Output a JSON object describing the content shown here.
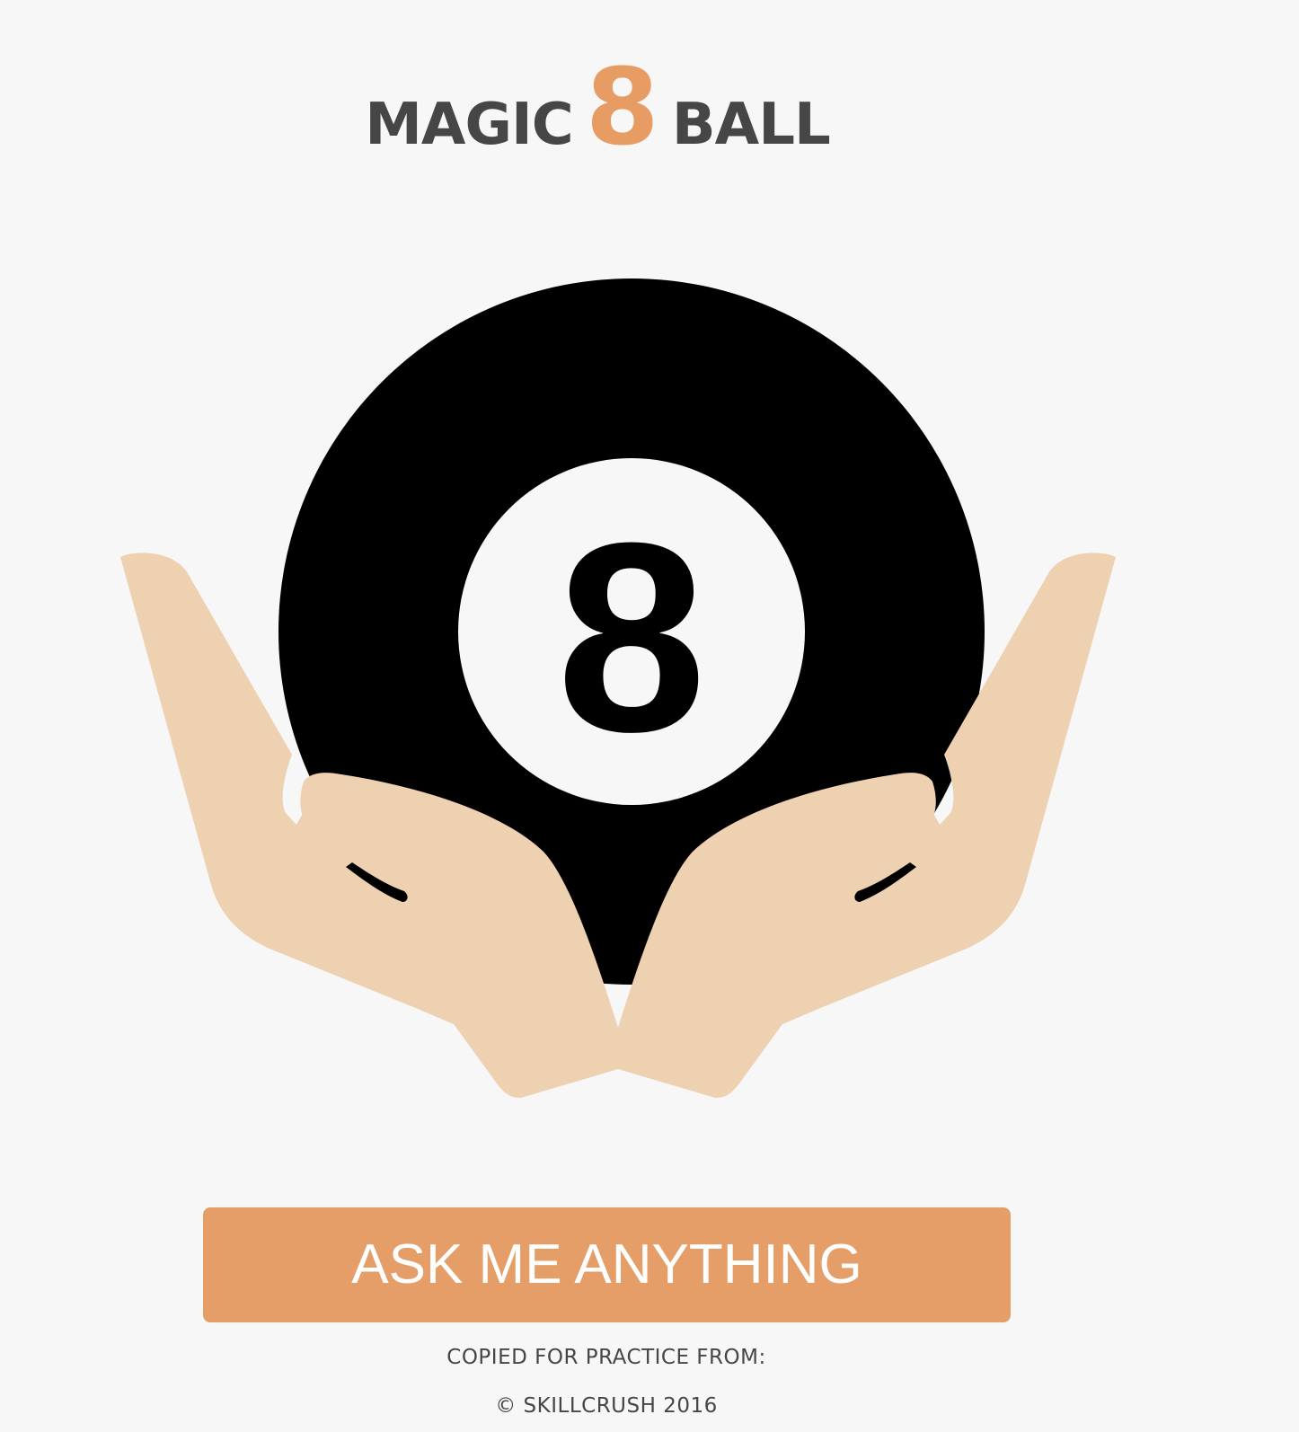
{
  "header": {
    "title_left": "MAGIC",
    "title_number": "8",
    "title_right": "BALL"
  },
  "ball": {
    "number": "8",
    "icon": "magic-8-ball-icon"
  },
  "hands": {
    "icon": "cupped-hands-icon"
  },
  "actions": {
    "ask_label": "ASK ME ANYTHING"
  },
  "footer": {
    "line1": "COPIED FOR PRACTICE FROM:",
    "line2": "© SKILLCRUSH 2016"
  },
  "colors": {
    "background": "#f7f7f7",
    "accent": "#e59e67",
    "title_text": "#464646",
    "ball": "#000000",
    "skin": "#edd1b1"
  }
}
